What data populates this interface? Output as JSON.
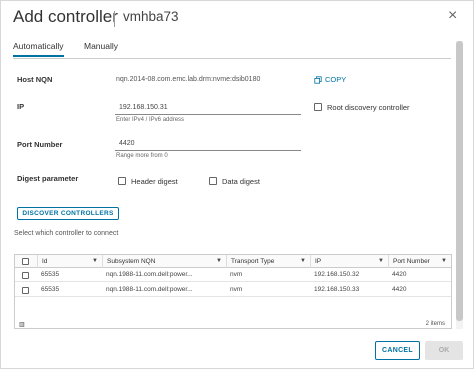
{
  "dialog": {
    "title": "Add controller",
    "subtitle": "vmhba73",
    "close_label": "×"
  },
  "tabs": [
    {
      "label": "Automatically",
      "active": true
    },
    {
      "label": "Manually",
      "active": false
    }
  ],
  "form": {
    "host_nqn_label": "Host NQN",
    "host_nqn_value": "nqn.2014-08.com.emc.lab.drm:nvme:dsib0180",
    "copy_label": "COPY",
    "ip_label": "IP",
    "ip_value": "192.168.150.31",
    "ip_hint": "Enter IPv4 / IPv6 address",
    "root_discovery_label": "Root discovery controller",
    "port_label": "Port Number",
    "port_value": "4420",
    "port_hint": "Range more from 0",
    "digest_label": "Digest parameter",
    "header_digest_label": "Header digest",
    "data_digest_label": "Data digest",
    "discover_button": "DISCOVER CONTROLLERS",
    "select_hint": "Select which controller to connect"
  },
  "grid": {
    "columns": [
      "Id",
      "Subsystem NQN",
      "Transport Type",
      "IP",
      "Port Number"
    ],
    "rows": [
      {
        "id": "65535",
        "nqn": "nqn.1988-11.com.dell:power...",
        "transport": "nvm",
        "ip": "192.168.150.32",
        "port": "4420"
      },
      {
        "id": "65535",
        "nqn": "nqn.1988-11.com.dell:power...",
        "transport": "nvm",
        "ip": "192.168.150.33",
        "port": "4420"
      }
    ],
    "item_count": "2 items"
  },
  "footer": {
    "cancel_label": "CANCEL",
    "ok_label": "OK"
  },
  "colors": {
    "accent": "#0072a3",
    "disabled_bg": "#e4e4e4"
  }
}
